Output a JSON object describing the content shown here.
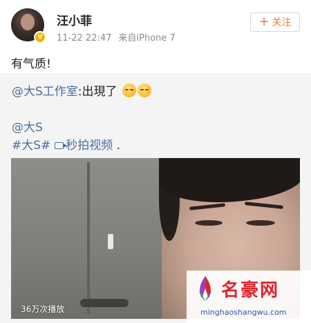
{
  "post": {
    "username": "汪小菲",
    "time": "11-22 22:47",
    "source": "来自iPhone 7",
    "follow_label": "关注",
    "text": "有气质!"
  },
  "repost": {
    "mention": "@大S工作室",
    "text": ":出現了",
    "mention2": "@大S",
    "hashtag": "#大S#",
    "video_link": "秒拍视频",
    "trailing": " ."
  },
  "video": {
    "plays": "36万次播放"
  },
  "watermark": {
    "name": "名豪网",
    "url": "minghaoshangwu.com"
  },
  "icons": {
    "follow": "plus-icon",
    "verified": "verified-badge-icon",
    "video": "video-icon",
    "emoji": "smile-emoji-icon"
  },
  "colors": {
    "link": "#4a6e9e",
    "follow": "#e8793f",
    "repost_bg": "#f4f4f4",
    "watermark_red": "#e0242e"
  }
}
